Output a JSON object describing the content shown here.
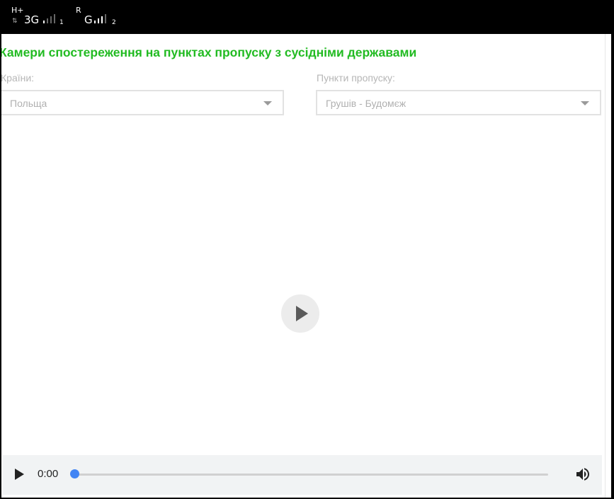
{
  "status_bar": {
    "sim1": {
      "network_sup": "H+",
      "tech": "3G",
      "sim_label": "1"
    },
    "sim2": {
      "roaming_sup": "R",
      "tech": "G",
      "sim_label": "2"
    }
  },
  "page": {
    "title": "Камери спостереження на пунктах пропуску з сусідніми державами"
  },
  "filters": {
    "country": {
      "label": "Країни:",
      "value": "Польща",
      "icon": "chevron-down-icon"
    },
    "checkpoint": {
      "label": "Пункти пропуску:",
      "value": "Грушів - Будомєж",
      "icon": "chevron-down-icon"
    }
  },
  "player": {
    "big_play_icon": "play-icon",
    "current_time": "0:00",
    "progress": 0,
    "volume_icon": "volume-icon",
    "accent_color": "#4285f4"
  },
  "colors": {
    "title": "#22bb22",
    "controls_bg": "#f1f3f4"
  }
}
